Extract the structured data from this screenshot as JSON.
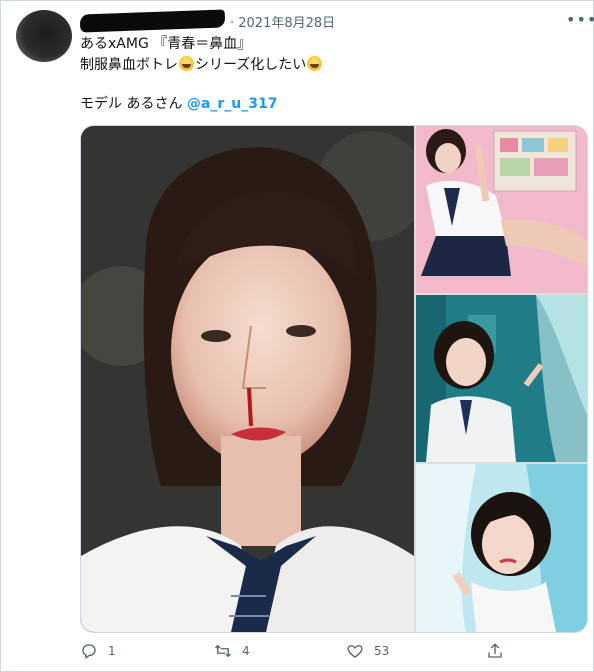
{
  "tweet": {
    "date": "2021年8月28日",
    "line1": "あるxAMG 『青春＝鼻血』",
    "line2_a": "制服鼻血ボトレ",
    "line2_b": "シリーズ化したい",
    "model_label": "モデル あるさん ",
    "model_handle": "@a_r_u_317"
  },
  "icons": [
    "avatar",
    "more-icon",
    "smiling-sweat-emoji",
    "reply-icon",
    "retweet-icon",
    "like-icon",
    "share-icon"
  ],
  "media": {
    "images": [
      "photo-large-left",
      "photo-top-right",
      "photo-middle-right",
      "photo-bottom-right"
    ]
  },
  "actions": {
    "replies": "1",
    "retweets": "4",
    "likes": "53"
  }
}
